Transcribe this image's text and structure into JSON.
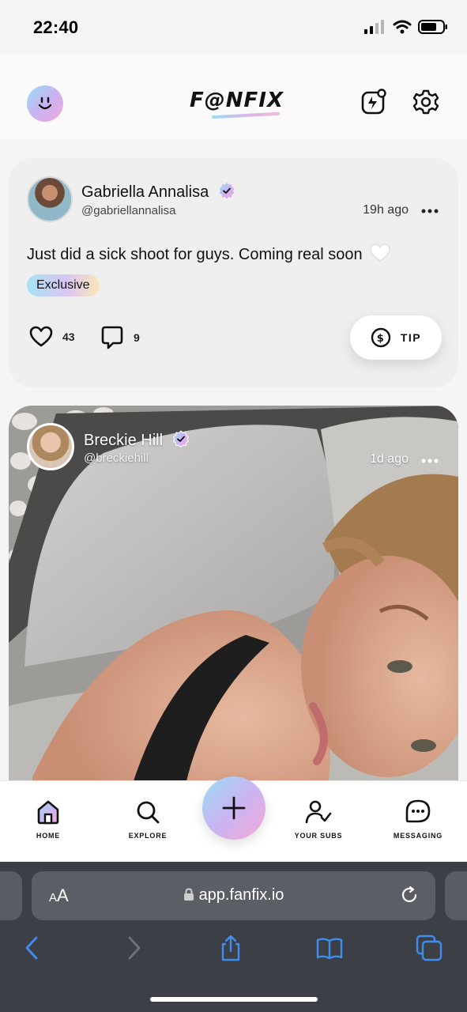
{
  "status_bar": {
    "time": "22:40"
  },
  "header": {
    "logo": "F@NFIX"
  },
  "posts": [
    {
      "name": "Gabriella Annalisa",
      "handle": "@gabriellannalisa",
      "time": "19h ago",
      "text": "Just did a sick shoot for guys. Coming real soon",
      "badge": "Exclusive",
      "likes": "43",
      "comments": "9",
      "tip_label": "TIP"
    },
    {
      "name": "Breckie Hill",
      "handle": "@breckiehill",
      "time": "1d ago"
    }
  ],
  "nav": {
    "home": "HOME",
    "explore": "EXPLORE",
    "subs": "YOUR SUBS",
    "messaging": "MESSAGING"
  },
  "browser": {
    "aa_small": "A",
    "aa_large": "A",
    "url": "app.fanfix.io"
  },
  "colors": {
    "gradient_start": "#9bdcf2",
    "gradient_mid": "#c9b5f3",
    "gradient_end": "#f4a8d6"
  }
}
